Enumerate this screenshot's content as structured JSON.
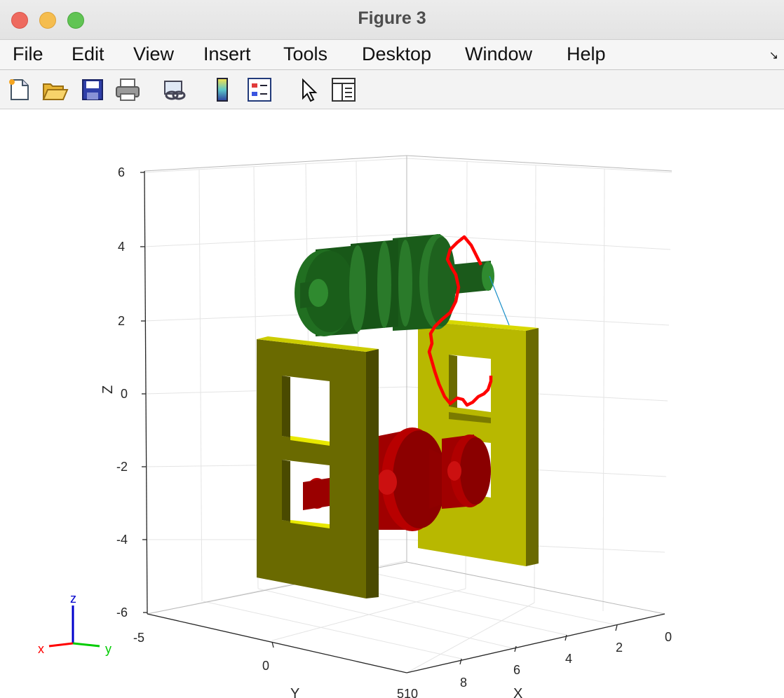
{
  "window": {
    "title": "Figure 3"
  },
  "menu": {
    "file": "File",
    "edit": "Edit",
    "view": "View",
    "insert": "Insert",
    "tools": "Tools",
    "desktop": "Desktop",
    "window": "Window",
    "help": "Help"
  },
  "toolbar": {
    "icons": [
      "new-figure-icon",
      "open-file-icon",
      "save-icon",
      "print-icon",
      "link-icon",
      "colorbar-icon",
      "legend-icon",
      "pointer-icon",
      "property-editor-icon"
    ]
  },
  "axes": {
    "zlabel": "Z",
    "ylabel": "Y",
    "xlabel": "X",
    "z_ticks": [
      "6",
      "4",
      "2",
      "0",
      "-2",
      "-4",
      "-6"
    ],
    "y_ticks": [
      "-5",
      "0",
      "5"
    ],
    "y_tick_5_overlap": "510",
    "x_ticks": [
      "10",
      "8",
      "6",
      "4",
      "2",
      "0"
    ]
  },
  "triad": {
    "x": "x",
    "y": "y",
    "z": "z"
  },
  "colors": {
    "green_part": "#1f6b1f",
    "red_part": "#c00000",
    "yellow_frame": "#b5b500",
    "trajectory": "#ff0000",
    "triad_x": "#ff0000",
    "triad_y": "#00cc00",
    "triad_z": "#0000cc"
  }
}
